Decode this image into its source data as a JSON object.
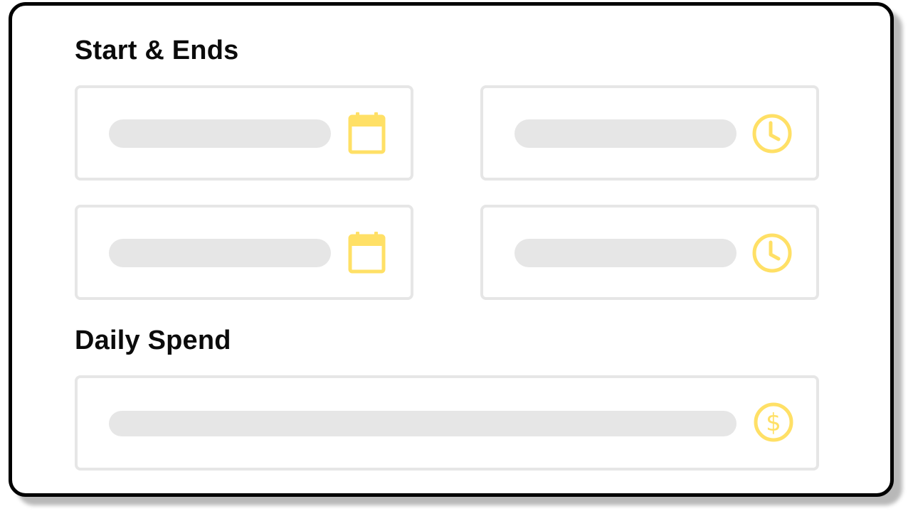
{
  "form": {
    "schedule_section": {
      "title": "Start & Ends",
      "fields": [
        {
          "role": "start-date",
          "icon": "calendar-icon"
        },
        {
          "role": "start-time",
          "icon": "clock-icon"
        },
        {
          "role": "end-date",
          "icon": "calendar-icon"
        },
        {
          "role": "end-time",
          "icon": "clock-icon"
        }
      ]
    },
    "spend_section": {
      "title": "Daily Spend",
      "fields": [
        {
          "role": "daily-budget",
          "icon": "dollar-icon"
        }
      ]
    }
  },
  "colors": {
    "accent_icon": "#FFE066",
    "field_border": "#E6E6E6",
    "placeholder_bar": "#E6E6E6",
    "card_border": "#000000",
    "title_text": "#0B0B0B"
  }
}
